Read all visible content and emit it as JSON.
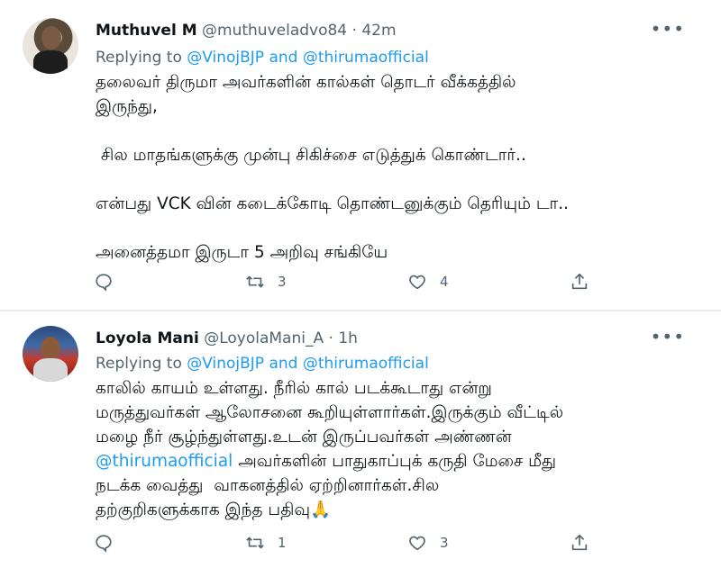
{
  "tweets": [
    {
      "name": "Muthuvel M",
      "handle": "@muthuveladvo84",
      "time": "42m",
      "replying_prefix": "Replying to",
      "replying_to": "@VinojBJP and @thirumaofficial",
      "lines": [
        "தலைவர் திருமா அவர்களின் கால்கள் தொடர் வீக்கத்தில்",
        "இருந்து,",
        "",
        " சில மாதங்களுக்கு முன்பு சிகிச்சை எடுத்துக் கொண்டார்..",
        "",
        "என்பது VCK வின் கடைக்கோடி தொண்டனுக்கும் தெரியும் டா..",
        "",
        "அனைத்தமா இருடா 5 அறிவு சங்கியே"
      ],
      "retweets": "3",
      "likes": "4"
    },
    {
      "name": "Loyola Mani",
      "handle": "@LoyolaMani_A",
      "time": "1h",
      "replying_prefix": "Replying to",
      "replying_to": "@VinojBJP and @thirumaofficial",
      "line1": "காலில் காயம் உள்ளது. நீரில் கால் படக்கூடாது என்று",
      "line2": "மருத்துவர்கள் ஆலோசனை கூறியுள்ளார்கள்.இருக்கும் வீட்டில்",
      "line3": "மழை நீர் சூழ்ந்துள்ளது.உடன் இருப்பவர்கள் அண்ணன்",
      "line4_link": "@thirumaofficial",
      "line4_rest": " அவர்களின் பாதுகாப்புக் கருதி மேசை மீது",
      "line5": "நடக்க வைத்து  வாகனத்தில் ஏற்றினார்கள்.சில",
      "line6": "தற்குறிகளுக்காக இந்த பதிவு🙏",
      "retweets": "1",
      "likes": "3"
    }
  ],
  "icons": [
    "reply-icon",
    "retweet-icon",
    "like-icon",
    "share-icon",
    "more-icon"
  ],
  "colors": {
    "link": "#1d9bf0",
    "secondary": "#536471",
    "text": "#0f1419",
    "divider": "#e7e9ea"
  }
}
